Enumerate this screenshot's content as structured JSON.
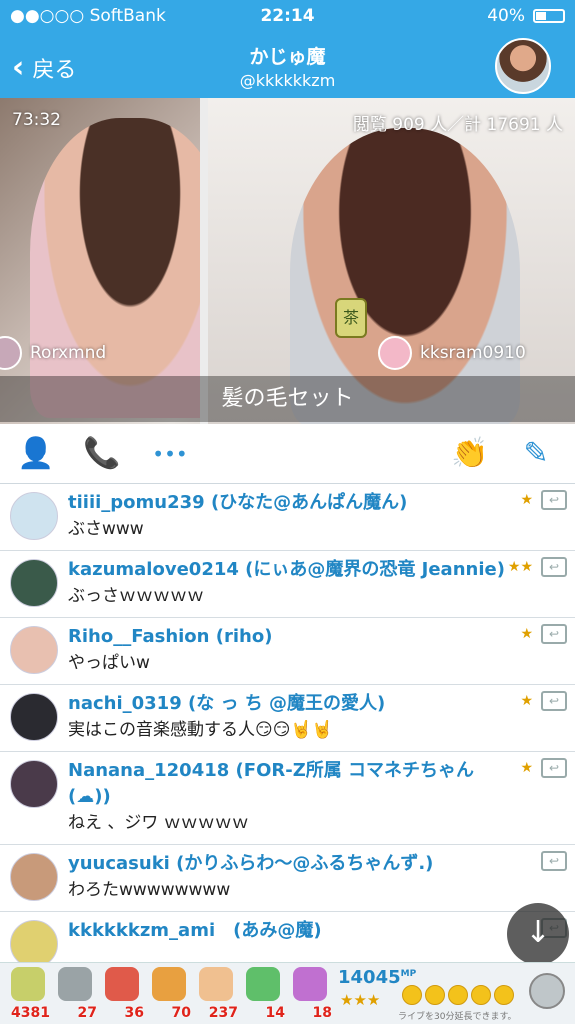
{
  "status": {
    "carrier": "●●○○○ SoftBank",
    "time": "22:14",
    "battery": "40%",
    "battery_level": 0.4
  },
  "nav": {
    "back_label": "戻る",
    "title": "かじゅ魔",
    "handle": "@kkkkkkzm"
  },
  "video": {
    "timer": "73:32",
    "views": "閲覧 909 人／計 17691 人",
    "viewer_left": "Rorxmnd",
    "viewer_right": "kksram0910",
    "gift_glyph": "茶",
    "caption": "髪の毛セット"
  },
  "actions": {
    "icons": [
      "profile-check-icon",
      "call-icon",
      "more-icon",
      "clap-icon",
      "compose-icon"
    ],
    "more_glyph": "•••"
  },
  "comments": [
    {
      "user": "tiiii_pomu239 (ひなた@あんぱん魔ん)",
      "msg": "ぶさwww",
      "badge": "★",
      "avatar_color": "#cfe3ef"
    },
    {
      "user": "kazumalove0214 (にぃあ@魔界の恐竜 Jeannie)",
      "msg": "ぶっさｗｗｗｗｗ",
      "badge": "★★",
      "avatar_color": "#3a5a4a"
    },
    {
      "user": "Riho__Fashion (riho)",
      "msg": "やっぱいw",
      "badge": "★",
      "avatar_color": "#e8c0b0"
    },
    {
      "user": "nachi_0319 (な っ ち @魔王の愛人)",
      "msg": "実はこの音楽感動する人😏😏🤘🤘",
      "badge": "★",
      "avatar_color": "#2a2a30"
    },
    {
      "user": "Nanana_120418 (FOR-Z所属 コマネチちゃん (☁))",
      "msg": "ねえ 、ジワ ｗｗｗｗｗ",
      "badge": "★",
      "avatar_color": "#4a3a4a"
    },
    {
      "user": "yuucasuki (かりふらわ〜@ふるちゃんず.)",
      "msg": "わろたwwwwwwww",
      "badge": "",
      "avatar_color": "#c89a7a"
    },
    {
      "user": "kkkkkkzm_ami　(あみ@魔)",
      "msg": "",
      "badge": "",
      "avatar_color": "#e0d070"
    }
  ],
  "reply_glyph": "↩",
  "scroll_glyph": "↓",
  "tray": {
    "gifts": [
      {
        "name": "tea-icon",
        "count": "4381",
        "color": "#c7cf6a"
      },
      {
        "name": "ufo-icon",
        "count": "27",
        "color": "#9aa3a6"
      },
      {
        "name": "strawberry-icon",
        "count": "36",
        "color": "#e05a4a"
      },
      {
        "name": "megaphone-icon",
        "count": "70",
        "color": "#e8a040"
      },
      {
        "name": "clap-icon",
        "count": "237",
        "color": "#f0c090"
      },
      {
        "name": "sparkle-icon",
        "count": "14",
        "color": "#5fbf6a"
      },
      {
        "name": "bear-icon",
        "count": "18",
        "color": "#c070d0"
      }
    ],
    "mp_value": "14045",
    "mp_unit": "MP",
    "stars": "★★★",
    "coins": 5,
    "note": "ライブを30分延長できます。"
  }
}
